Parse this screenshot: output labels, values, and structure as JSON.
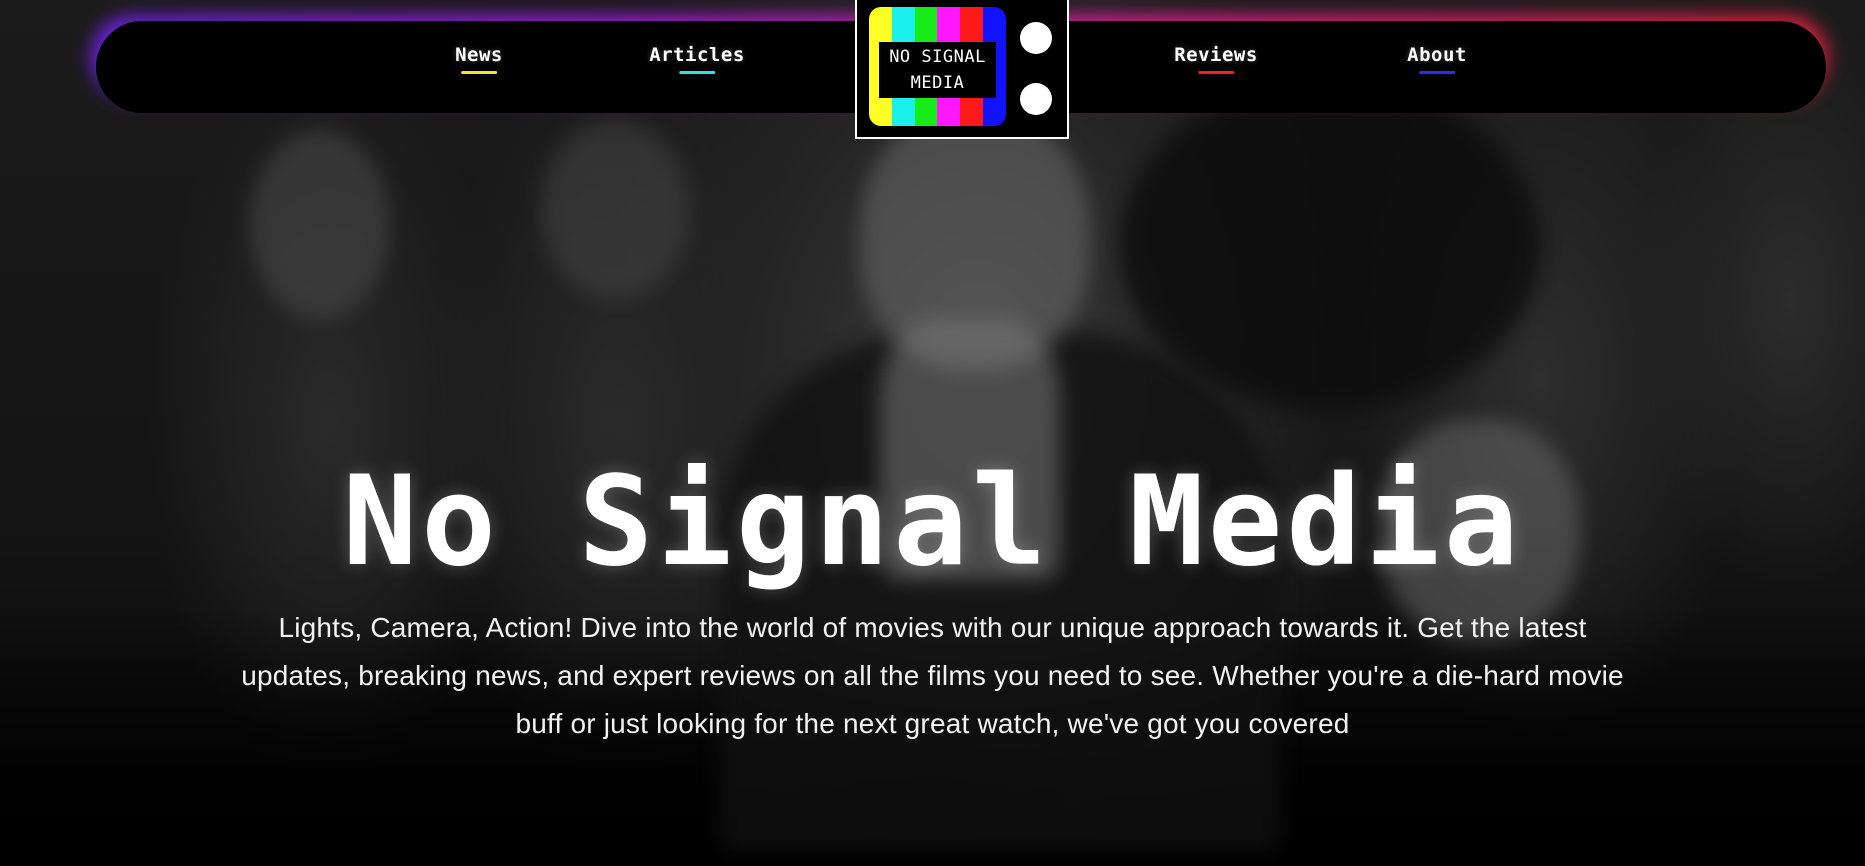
{
  "nav": {
    "links": [
      {
        "label": "News",
        "underline_color": "#f3e81c"
      },
      {
        "label": "Articles",
        "underline_color": "#2fe3d6"
      },
      {
        "label": "Reviews",
        "underline_color": "#ff1c1c"
      },
      {
        "label": "About",
        "underline_color": "#2b2bff"
      }
    ],
    "glow_colors": [
      "#7a22ff",
      "#ff1ea8",
      "#ff2040"
    ]
  },
  "logo": {
    "line1": "NO SIGNAL",
    "line2": "MEDIA",
    "color_bars": [
      "#ffff24",
      "#19f0ec",
      "#18ec18",
      "#ff18ff",
      "#ff1a1a",
      "#1212ff"
    ],
    "icon": "tv-color-bars-icon"
  },
  "hero": {
    "title": "No Signal Media",
    "subtitle": "Lights, Camera, Action! Dive into the world of movies with our unique approach towards it. Get the latest updates, breaking news, and expert reviews on all the films you need to see. Whether you're a die-hard movie buff or just looking for the next great watch, we've got you covered"
  }
}
